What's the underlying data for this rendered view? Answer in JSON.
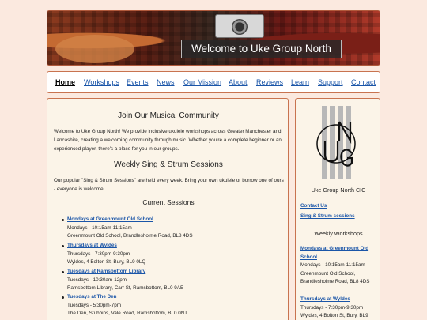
{
  "header": {
    "title": "Welcome to Uke Group North"
  },
  "nav": {
    "items": [
      {
        "label": "Home",
        "active": true
      },
      {
        "label": "Workshops"
      },
      {
        "label": "Events"
      },
      {
        "label": "News"
      },
      {
        "label": "Our Mission"
      },
      {
        "label": "About"
      },
      {
        "label": "Reviews"
      },
      {
        "label": "Learn"
      },
      {
        "label": "Support"
      },
      {
        "label": "Contact"
      }
    ]
  },
  "main": {
    "heading": "Join Our Musical Community",
    "intro": "Welcome to Uke Group North! We provide inclusive ukulele workshops across Greater Manchester and Lancashire, creating a welcoming community through music. Whether you're a complete beginner or an experienced player, there's a place for you in our groups.",
    "weekly_heading": "Weekly Sing & Strum Sessions",
    "weekly_text": "Our popular \"Sing & Strum Sessions\" are held every week. Bring your own ukulele or borrow one of ours - everyone is welcome!",
    "sessions_heading": "Current Sessions",
    "sessions": [
      {
        "title": "Mondays at Greenmount Old School",
        "time": "Mondays - 10:15am-11:15am",
        "place": "Greenmount Old School, Brandlesholme Road, BL8 4DS"
      },
      {
        "title": "Thursdays at Wyldes",
        "time": "Thursdays - 7:30pm-9:30pm",
        "place": "Wyldes, 4 Bolton St, Bury, BL9 0LQ"
      },
      {
        "title": "Tuesdays at Ramsbottom Library",
        "time": "Tuesdays - 10:30am-12pm",
        "place": "Ramsbottom Library, Carr St, Ramsbottom, BL0 9AE"
      },
      {
        "title": "Tuesdays at The Den",
        "time": "Tuesdays - 5:30pm-7pm",
        "place": "The Den, Stubbins, Vale Road, Ramsbottom, BL0 0NT"
      }
    ]
  },
  "sidebar": {
    "org_name": "Uke Group North CIC",
    "links": [
      "Contact Us",
      "Sing & Strum sessions"
    ],
    "workshops_heading": "Weekly Workshops",
    "workshops": [
      {
        "title": "Mondays at Greenmount Old School",
        "time": "Mondays - 10:15am-11:15am",
        "place": "Greenmount Old School, Brandlesholme Road, BL8 4DS"
      },
      {
        "title": "Thursdays at Wyldes",
        "time": "Thursdays - 7:30pm-9:30pm",
        "place": "Wyldes, 4 Bolton St, Bury, BL9"
      }
    ]
  },
  "colors": {
    "background": "#fbe9df",
    "panel": "#fbf4e8",
    "border": "#c8734f",
    "link": "#1a55a8"
  }
}
